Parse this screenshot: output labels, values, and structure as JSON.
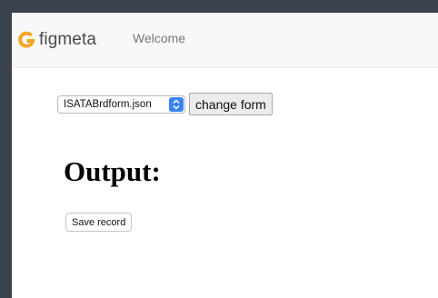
{
  "navbar": {
    "brand_icon": "figmeta-logo-icon",
    "brand_name": "figmeta",
    "links": [
      {
        "label": "Welcome"
      }
    ]
  },
  "form": {
    "selected_file": "ISATABrdform.json",
    "change_button_label": "change form"
  },
  "output": {
    "heading": "Output:",
    "save_button_label": "Save record"
  },
  "colors": {
    "background": "#39424d",
    "navbar": "#f8f8f8",
    "brand_icon": "#f5a623",
    "select_accent": "#3b82f6"
  }
}
